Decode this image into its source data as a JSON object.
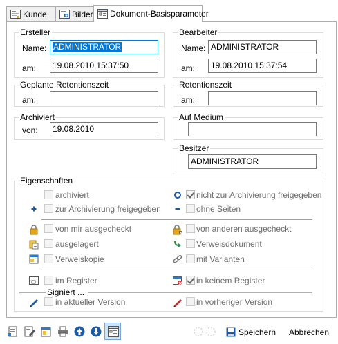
{
  "tabs": [
    {
      "label": "Kunde",
      "icon": "customer-icon"
    },
    {
      "label": "Bilder",
      "icon": "images-icon"
    },
    {
      "label": "Dokument-Basisparameter",
      "icon": "document-params-icon"
    }
  ],
  "creator": {
    "title": "Ersteller",
    "name_label": "Name:",
    "name_value": "ADMINISTRATOR",
    "date_label": "am:",
    "date_value": "19.08.2010 15:37:50"
  },
  "editor": {
    "title": "Bearbeiter",
    "name_label": "Name:",
    "name_value": "ADMINISTRATOR",
    "date_label": "am:",
    "date_value": "19.08.2010 15:37:54"
  },
  "planned_retention": {
    "title": "Geplante Retentionszeit",
    "date_label": "am:",
    "date_value": ""
  },
  "retention": {
    "title": "Retentionszeit",
    "date_label": "am:",
    "date_value": ""
  },
  "archived": {
    "title": "Archiviert",
    "from_label": "von:",
    "from_value": "19.08.2010"
  },
  "medium": {
    "title": "Auf Medium",
    "value": ""
  },
  "owner": {
    "title": "Besitzer",
    "value": "ADMINISTRATOR"
  },
  "properties": {
    "title": "Eigenschaften",
    "items": [
      {
        "label": "archiviert",
        "checked": false,
        "icon": ""
      },
      {
        "label": "nicht zur Archivierung freigegeben",
        "checked": true,
        "icon": "circle-icon"
      },
      {
        "label": "zur Archivierung freigegeben",
        "checked": false,
        "icon": "plus-icon"
      },
      {
        "label": "ohne Seiten",
        "checked": false,
        "icon": "minus-icon"
      },
      {
        "label": "von mir ausgecheckt",
        "checked": false,
        "icon": "lock-icon"
      },
      {
        "label": "von anderen ausgecheckt",
        "checked": false,
        "icon": "lock-other-icon"
      },
      {
        "label": "ausgelagert",
        "checked": false,
        "icon": "outsourced-icon"
      },
      {
        "label": "Verweisdokument",
        "checked": false,
        "icon": "reference-arrow-icon"
      },
      {
        "label": "Verweiskopie",
        "checked": false,
        "icon": "reference-copy-icon"
      },
      {
        "label": "mit Varianten",
        "checked": false,
        "icon": "variants-link-icon"
      },
      {
        "label": "im Register",
        "checked": false,
        "icon": "register-icon"
      },
      {
        "label": "in keinem Register",
        "checked": true,
        "icon": "no-register-icon"
      }
    ],
    "signed_title": "Signiert ...",
    "signed_items": [
      {
        "label": "in aktueller Version",
        "checked": false,
        "icon": "pen-blue-icon"
      },
      {
        "label": "in vorheriger Version",
        "checked": false,
        "icon": "pen-red-icon"
      }
    ]
  },
  "footer": {
    "save_label": "Speichern",
    "cancel_label": "Abbrechen"
  },
  "colors": {
    "selection": "#0078d7",
    "disabled_text": "#6d6d6d",
    "focus_border": "#0078d7"
  }
}
